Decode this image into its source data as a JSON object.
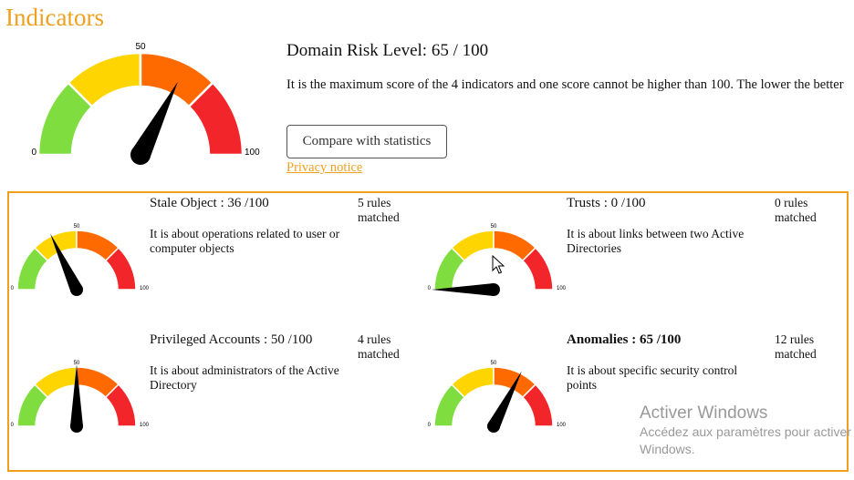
{
  "page": {
    "title": "Indicators"
  },
  "main": {
    "gauge_label_min": "0",
    "gauge_label_mid": "50",
    "gauge_label_max": "100",
    "gauge_value": 65,
    "risk_title": "Domain Risk Level: 65 / 100",
    "description": "It is the maximum score of the 4 indicators and one score cannot be higher than 100. The lower the better",
    "compare_button": "Compare with statistics",
    "privacy_link": "Privacy notice"
  },
  "indicators": [
    {
      "title": "Stale Object : 36 /100",
      "value": 36,
      "bold": false,
      "description": "It is about operations related to user or computer objects",
      "rules": "5 rules matched"
    },
    {
      "title": "Trusts : 0 /100",
      "value": 0,
      "bold": false,
      "description": "It is about links between two Active Directories",
      "rules": "0 rules matched"
    },
    {
      "title": "Privileged Accounts : 50 /100",
      "value": 50,
      "bold": false,
      "description": "It is about administrators of the Active Directory",
      "rules": "4 rules matched"
    },
    {
      "title": "Anomalies : 65 /100",
      "value": 65,
      "bold": true,
      "description": "It is about specific security control points",
      "rules": "12 rules matched"
    }
  ],
  "colors": {
    "green": "#7fdd3f",
    "yellow": "#ffd500",
    "orange": "#ff6a00",
    "red": "#f2262a",
    "accent": "#f0a020"
  },
  "watermark": {
    "title": "Activer Windows",
    "line1": "Accédez aux paramètres pour activer",
    "line2": "Windows."
  }
}
